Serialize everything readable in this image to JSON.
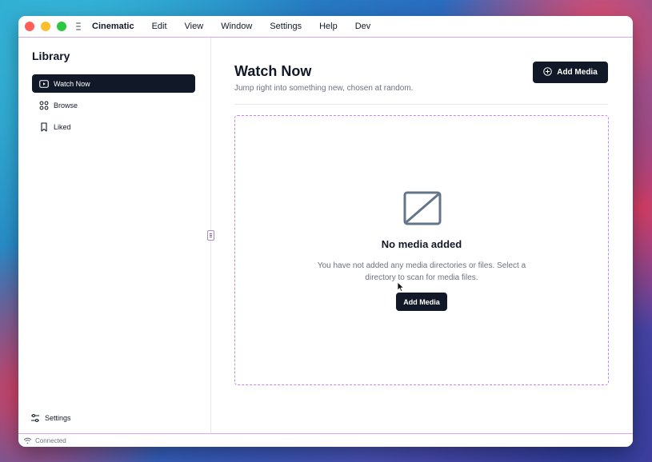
{
  "menubar": {
    "app_name": "Cinematic",
    "items": [
      "Edit",
      "View",
      "Window",
      "Settings",
      "Help",
      "Dev"
    ]
  },
  "sidebar": {
    "title": "Library",
    "items": [
      {
        "label": "Watch Now",
        "icon": "play-icon",
        "active": true
      },
      {
        "label": "Browse",
        "icon": "grid-icon",
        "active": false
      },
      {
        "label": "Liked",
        "icon": "bookmark-icon",
        "active": false
      }
    ],
    "settings_label": "Settings"
  },
  "main": {
    "title": "Watch Now",
    "subtitle": "Jump right into something new, chosen at random.",
    "add_media_label": "Add Media",
    "empty_state": {
      "title": "No media added",
      "description": "You have not added any media directories or files. Select a directory to scan for media files.",
      "button_label": "Add Media"
    }
  },
  "status": {
    "text": "Connected",
    "icon": "wifi-icon"
  },
  "colors": {
    "primary": "#111827",
    "accent_border": "#c084fc",
    "muted_text": "#6b7280"
  }
}
